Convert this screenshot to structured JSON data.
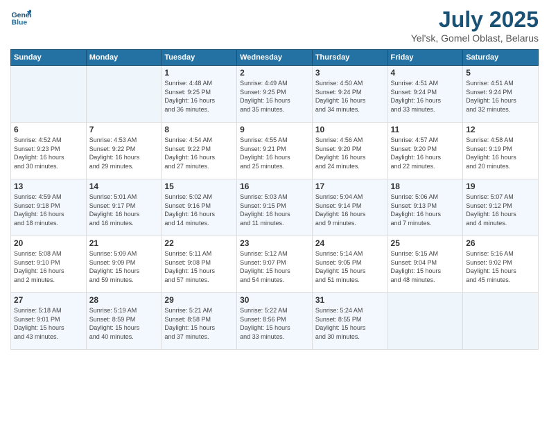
{
  "header": {
    "logo_line1": "General",
    "logo_line2": "Blue",
    "month_title": "July 2025",
    "location": "Yel'sk, Gomel Oblast, Belarus"
  },
  "days_of_week": [
    "Sunday",
    "Monday",
    "Tuesday",
    "Wednesday",
    "Thursday",
    "Friday",
    "Saturday"
  ],
  "weeks": [
    [
      {
        "day": "",
        "info": ""
      },
      {
        "day": "",
        "info": ""
      },
      {
        "day": "1",
        "info": "Sunrise: 4:48 AM\nSunset: 9:25 PM\nDaylight: 16 hours\nand 36 minutes."
      },
      {
        "day": "2",
        "info": "Sunrise: 4:49 AM\nSunset: 9:25 PM\nDaylight: 16 hours\nand 35 minutes."
      },
      {
        "day": "3",
        "info": "Sunrise: 4:50 AM\nSunset: 9:24 PM\nDaylight: 16 hours\nand 34 minutes."
      },
      {
        "day": "4",
        "info": "Sunrise: 4:51 AM\nSunset: 9:24 PM\nDaylight: 16 hours\nand 33 minutes."
      },
      {
        "day": "5",
        "info": "Sunrise: 4:51 AM\nSunset: 9:24 PM\nDaylight: 16 hours\nand 32 minutes."
      }
    ],
    [
      {
        "day": "6",
        "info": "Sunrise: 4:52 AM\nSunset: 9:23 PM\nDaylight: 16 hours\nand 30 minutes."
      },
      {
        "day": "7",
        "info": "Sunrise: 4:53 AM\nSunset: 9:22 PM\nDaylight: 16 hours\nand 29 minutes."
      },
      {
        "day": "8",
        "info": "Sunrise: 4:54 AM\nSunset: 9:22 PM\nDaylight: 16 hours\nand 27 minutes."
      },
      {
        "day": "9",
        "info": "Sunrise: 4:55 AM\nSunset: 9:21 PM\nDaylight: 16 hours\nand 25 minutes."
      },
      {
        "day": "10",
        "info": "Sunrise: 4:56 AM\nSunset: 9:20 PM\nDaylight: 16 hours\nand 24 minutes."
      },
      {
        "day": "11",
        "info": "Sunrise: 4:57 AM\nSunset: 9:20 PM\nDaylight: 16 hours\nand 22 minutes."
      },
      {
        "day": "12",
        "info": "Sunrise: 4:58 AM\nSunset: 9:19 PM\nDaylight: 16 hours\nand 20 minutes."
      }
    ],
    [
      {
        "day": "13",
        "info": "Sunrise: 4:59 AM\nSunset: 9:18 PM\nDaylight: 16 hours\nand 18 minutes."
      },
      {
        "day": "14",
        "info": "Sunrise: 5:01 AM\nSunset: 9:17 PM\nDaylight: 16 hours\nand 16 minutes."
      },
      {
        "day": "15",
        "info": "Sunrise: 5:02 AM\nSunset: 9:16 PM\nDaylight: 16 hours\nand 14 minutes."
      },
      {
        "day": "16",
        "info": "Sunrise: 5:03 AM\nSunset: 9:15 PM\nDaylight: 16 hours\nand 11 minutes."
      },
      {
        "day": "17",
        "info": "Sunrise: 5:04 AM\nSunset: 9:14 PM\nDaylight: 16 hours\nand 9 minutes."
      },
      {
        "day": "18",
        "info": "Sunrise: 5:06 AM\nSunset: 9:13 PM\nDaylight: 16 hours\nand 7 minutes."
      },
      {
        "day": "19",
        "info": "Sunrise: 5:07 AM\nSunset: 9:12 PM\nDaylight: 16 hours\nand 4 minutes."
      }
    ],
    [
      {
        "day": "20",
        "info": "Sunrise: 5:08 AM\nSunset: 9:10 PM\nDaylight: 16 hours\nand 2 minutes."
      },
      {
        "day": "21",
        "info": "Sunrise: 5:09 AM\nSunset: 9:09 PM\nDaylight: 15 hours\nand 59 minutes."
      },
      {
        "day": "22",
        "info": "Sunrise: 5:11 AM\nSunset: 9:08 PM\nDaylight: 15 hours\nand 57 minutes."
      },
      {
        "day": "23",
        "info": "Sunrise: 5:12 AM\nSunset: 9:07 PM\nDaylight: 15 hours\nand 54 minutes."
      },
      {
        "day": "24",
        "info": "Sunrise: 5:14 AM\nSunset: 9:05 PM\nDaylight: 15 hours\nand 51 minutes."
      },
      {
        "day": "25",
        "info": "Sunrise: 5:15 AM\nSunset: 9:04 PM\nDaylight: 15 hours\nand 48 minutes."
      },
      {
        "day": "26",
        "info": "Sunrise: 5:16 AM\nSunset: 9:02 PM\nDaylight: 15 hours\nand 45 minutes."
      }
    ],
    [
      {
        "day": "27",
        "info": "Sunrise: 5:18 AM\nSunset: 9:01 PM\nDaylight: 15 hours\nand 43 minutes."
      },
      {
        "day": "28",
        "info": "Sunrise: 5:19 AM\nSunset: 8:59 PM\nDaylight: 15 hours\nand 40 minutes."
      },
      {
        "day": "29",
        "info": "Sunrise: 5:21 AM\nSunset: 8:58 PM\nDaylight: 15 hours\nand 37 minutes."
      },
      {
        "day": "30",
        "info": "Sunrise: 5:22 AM\nSunset: 8:56 PM\nDaylight: 15 hours\nand 33 minutes."
      },
      {
        "day": "31",
        "info": "Sunrise: 5:24 AM\nSunset: 8:55 PM\nDaylight: 15 hours\nand 30 minutes."
      },
      {
        "day": "",
        "info": ""
      },
      {
        "day": "",
        "info": ""
      }
    ]
  ]
}
